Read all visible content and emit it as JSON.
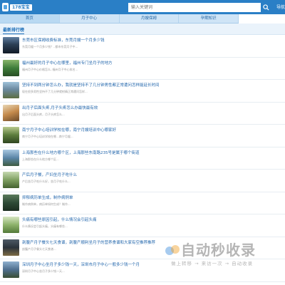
{
  "header": {
    "logo_text": "178宝宝",
    "search_placeholder": "输入关键词",
    "nav_label": "导航"
  },
  "navbar": [
    {
      "label": "首页",
      "active": true
    },
    {
      "label": "月子中心",
      "active": false
    },
    {
      "label": "月嫂保姆",
      "active": false
    },
    {
      "label": "孕期知识",
      "active": false
    }
  ],
  "section": {
    "title": "最新排行榜"
  },
  "items": [
    {
      "title": "东莞市区保姆收费标准，东莞月嫂一个月多少钱",
      "subtitle": "东莞月嫂一个月多少钱？..都市东莞月子中..."
    },
    {
      "title": "福州最好的月子中心在哪里，福州专门坐月子的地方",
      "subtitle": "福州月子中心价格怎么..福州月子中心排名..."
    },
    {
      "title": "坚持不到两分钟怎么办，我就是坚持不了几分钟男性都正常遭问怎样能延长时间",
      "subtitle": "现在很多男性坚持不了几分钟就射精正常遭问怎样..."
    },
    {
      "title": "出月子后面头疼,月子头疼怎么办最快最有效",
      "subtitle": "出月子后面头疼，月子头疼怎么..."
    },
    {
      "title": "南宁月子中心培训学校在哪，南宁月嫂培训中心哪家好",
      "subtitle": "南宁月子中心培训学校在哪...南宁月嫂..."
    },
    {
      "title": "上海那些在什么地方哪个区，上海那些东南路235号是属于哪个街道",
      "subtitle": "上海那些在什么地方哪个区..."
    },
    {
      "title": "产后月子餐，产妇坐月子吃什么",
      "subtitle": "产后坐月子吃什么好，坐月子吃什么..."
    },
    {
      "title": "抑郁病历单生成，制作病例单",
      "subtitle": "制作病例单，病历单如何生成？制作..."
    },
    {
      "title": "头痛有哪些原因引起，什么情况会引起头痛",
      "subtitle": "什么情况会引起头痛，头痛有哪些..."
    },
    {
      "title": "剖腹产月子餐头七天食谱，剖腹产顺利坐月子的营养食谱和大家有空推荐推荐",
      "subtitle": "剖腹产月子餐头七天食谱..."
    },
    {
      "title": "深圳月子中心坐月子多少钱一天，深圳市月子中心一般多少钱一个月",
      "subtitle": "深圳月子中心坐月子多少钱一天..."
    }
  ],
  "watermark": {
    "text": "自动秒收录",
    "sub": "做上转移 → 来访一次 → 自动收录"
  },
  "colors": {
    "header_bg": "#2a7fc6",
    "nav_bg": "#cfe4f6",
    "title_link": "#2568ad"
  }
}
